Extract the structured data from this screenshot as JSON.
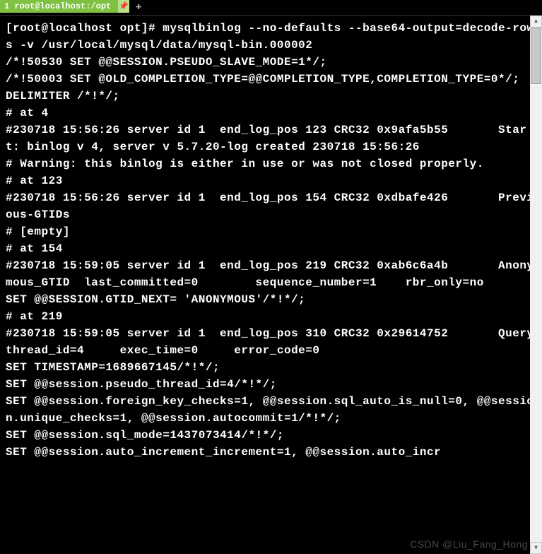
{
  "titlebar": {
    "tab_label": "1 root@localhost:/opt",
    "pin_glyph": "📌",
    "add_glyph": "✚"
  },
  "terminal": {
    "lines": [
      "[root@localhost opt]# mysqlbinlog --no-defaults --base64-output=decode-rows -v /usr/local/mysql/data/mysql-bin.000002",
      "/*!50530 SET @@SESSION.PSEUDO_SLAVE_MODE=1*/;",
      "/*!50003 SET @OLD_COMPLETION_TYPE=@@COMPLETION_TYPE,COMPLETION_TYPE=0*/;",
      "DELIMITER /*!*/;",
      "# at 4",
      "#230718 15:56:26 server id 1  end_log_pos 123 CRC32 0x9afa5b55       Start: binlog v 4, server v 5.7.20-log created 230718 15:56:26",
      "# Warning: this binlog is either in use or was not closed properly.",
      "# at 123",
      "#230718 15:56:26 server id 1  end_log_pos 154 CRC32 0xdbafe426       Previous-GTIDs",
      "# [empty]",
      "# at 154",
      "#230718 15:59:05 server id 1  end_log_pos 219 CRC32 0xab6c6a4b       Anonymous_GTID  last_committed=0        sequence_number=1    rbr_only=no",
      "SET @@SESSION.GTID_NEXT= 'ANONYMOUS'/*!*/;",
      "# at 219",
      "#230718 15:59:05 server id 1  end_log_pos 310 CRC32 0x29614752       Query   thread_id=4     exec_time=0     error_code=0",
      "SET TIMESTAMP=1689667145/*!*/;",
      "SET @@session.pseudo_thread_id=4/*!*/;",
      "SET @@session.foreign_key_checks=1, @@session.sql_auto_is_null=0, @@session.unique_checks=1, @@session.autocommit=1/*!*/;",
      "SET @@session.sql_mode=1437073414/*!*/;",
      "SET @@session.auto_increment_increment=1, @@session.auto_incr"
    ]
  },
  "scrollbar": {
    "up_glyph": "▲",
    "down_glyph": "▼"
  },
  "watermark": "CSDN @Liu_Fang_Hong"
}
